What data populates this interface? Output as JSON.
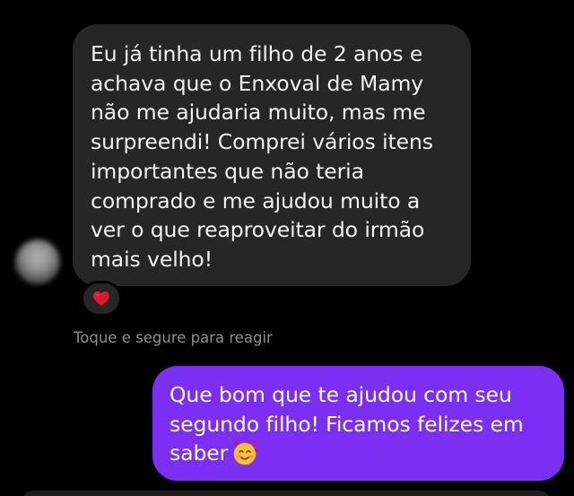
{
  "conversation": {
    "incoming_message": {
      "lines": [
        "Eu já tinha um filho de 2 anos e",
        "achava que o Enxoval de Mamy",
        "não me ajudaria muito, mas me",
        "surpreendi! Comprei vários itens",
        "importantes que não teria",
        "comprado e me ajudou muito a",
        "ver o que reaproveitar do irmão",
        "mais velho!"
      ],
      "reaction_icon": "red-heart-icon",
      "bubble_color": "#262626",
      "text_color": "#f2f2f2"
    },
    "reaction_hint": "Toque e segure para reagir",
    "outgoing_message": {
      "lines": [
        "Que bom que te ajudou com seu",
        "segundo filho! Ficamos felizes em",
        "saber"
      ],
      "emoji_icon": "smiling-face-with-hearts-icon",
      "bubble_color": "#7b2ff2",
      "text_color": "#ffffff"
    },
    "background_color": "#000000",
    "hint_color": "#8e8e8e",
    "heart_color": "#e0182d"
  }
}
